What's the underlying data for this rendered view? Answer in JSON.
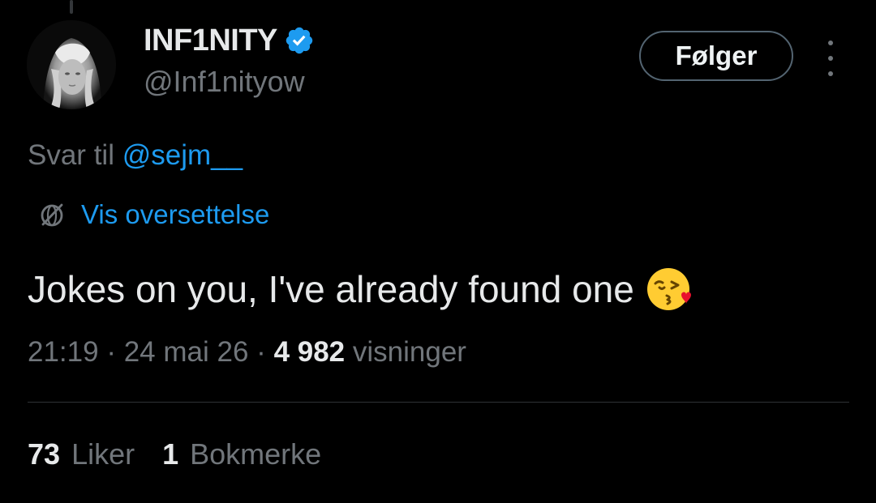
{
  "author": {
    "display_name": "INF1NITY",
    "handle": "@Inf1nityow",
    "verified": true,
    "avatar_icon": "profile-avatar"
  },
  "follow_button": {
    "label": "Følger"
  },
  "more_icon": "more-dots-vertical-icon",
  "reply": {
    "prefix": "Svar til",
    "mention": "@sejm__"
  },
  "translate": {
    "icon": "globe-icon",
    "label": "Vis oversettelse"
  },
  "tweet": {
    "text": "Jokes on you, I've already found one",
    "emoji": "face-blowing-a-kiss"
  },
  "meta": {
    "time": "21:19",
    "separator": "·",
    "date": "24 mai 26",
    "views_count": "4 982",
    "views_label": "visninger"
  },
  "stats": {
    "likes_count": "73",
    "likes_label": "Liker",
    "bookmarks_count": "1",
    "bookmarks_label": "Bokmerke"
  },
  "colors": {
    "background": "#000000",
    "text_primary": "#e7e9ea",
    "text_secondary": "#71767b",
    "accent": "#1d9bf0",
    "divider": "#2f3336"
  }
}
